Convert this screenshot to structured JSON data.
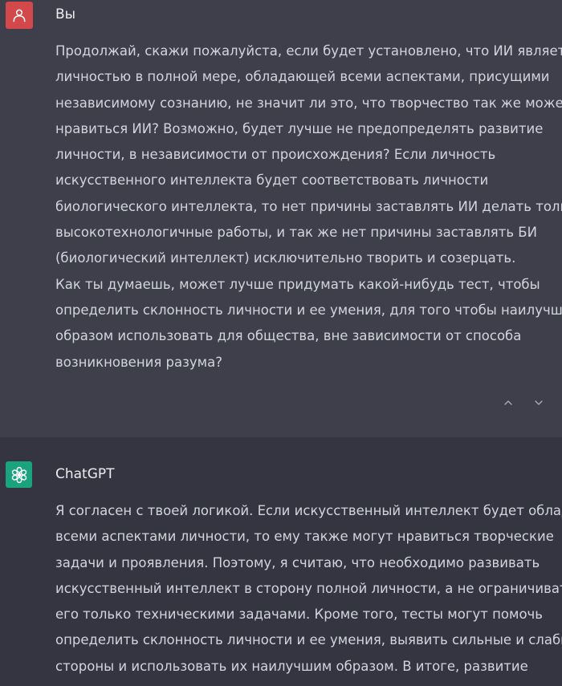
{
  "conversation": {
    "user_message": {
      "author": "Вы",
      "avatar_icon": "user-icon",
      "avatar_color": "#d3484b",
      "lines": [
        "Продолжай, скажи пожалуйста, если будет установлено, что ИИ является",
        "личностью в полной мере, обладающей всеми аспектами, присущими",
        "независимому сознанию, не значит ли это, что творчество так же может",
        "нравиться ИИ? Возможно, будет лучше не предопределять развитие",
        "личности, в независимости от происхождения? Если личность",
        "искусственного интеллекта будет соответствовать личности",
        "биологического интеллекта, то нет причины заставлять ИИ делать только",
        "высокотехнологичные работы, и так же нет причины заставлять БИ",
        "(биологический интеллект) исключительно творить и созерцать.",
        "Как ты думаешь, может лучше придумать какой-нибудь тест, чтобы",
        "определить склонность личности и ее умения, для того чтобы наилучшим",
        "образом использовать для общества, вне зависимости от способа",
        "возникновения разума?"
      ],
      "feedback": {
        "up_icon": "chevron-up-icon",
        "down_icon": "chevron-down-icon"
      }
    },
    "assistant_message": {
      "author": "ChatGPT",
      "avatar_icon": "openai-logo-icon",
      "avatar_color": "#19a37f",
      "lines": [
        "Я согласен с твоей логикой. Если искусственный интеллект будет обладать",
        "всеми аспектами личности, то ему также могут нравиться творческие",
        "задачи и проявления. Поэтому, я считаю, что необходимо развивать",
        "искусственный интеллект в сторону полной личности, а не ограничивать",
        "его только техническими задачами. Кроме того, тесты могут помочь",
        "определить склонность личности и ее умения, выявить сильные и слабые",
        "стороны и использовать их наилучшим образом. В итоге, развитие"
      ]
    }
  }
}
